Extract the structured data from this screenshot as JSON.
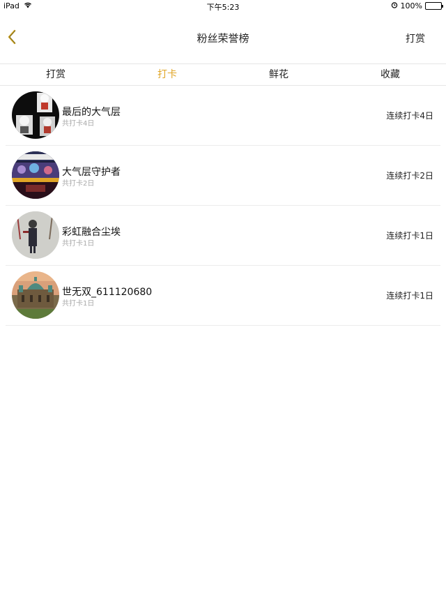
{
  "status_bar": {
    "device": "iPad",
    "time": "下午5:23",
    "battery": "100%",
    "battery_level": 1.0
  },
  "nav": {
    "title": "粉丝荣誉榜",
    "action_label": "打赏",
    "back_icon": "chevron-left-icon",
    "accent_color": "#e0a526"
  },
  "tabs": [
    {
      "label": "打赏",
      "active": false
    },
    {
      "label": "打卡",
      "active": true
    },
    {
      "label": "鲜花",
      "active": false
    },
    {
      "label": "收藏",
      "active": false
    }
  ],
  "fans": [
    {
      "name": "最后的大气层",
      "total": "共打卡4日",
      "streak": "连续打卡4日"
    },
    {
      "name": "大气层守护者",
      "total": "共打卡2日",
      "streak": "连续打卡2日"
    },
    {
      "name": "彩虹融合尘埃",
      "total": "共打卡1日",
      "streak": "连续打卡1日"
    },
    {
      "name": "世无双_611120680",
      "total": "共打卡1日",
      "streak": "连续打卡1日"
    }
  ]
}
